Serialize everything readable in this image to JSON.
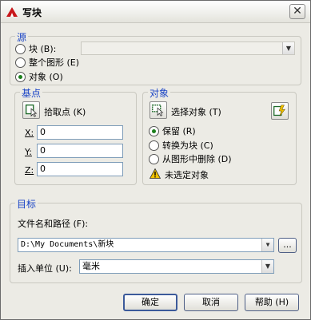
{
  "window": {
    "title": "写块",
    "close_glyph": "✕"
  },
  "source": {
    "label": "源",
    "opt_block": "块 (B):",
    "opt_entire": "整个图形 (E)",
    "opt_objects": "对象 (O)",
    "selected": "objects"
  },
  "base_point": {
    "label": "基点",
    "pick_label": "拾取点 (K)",
    "x_label": "X:",
    "x_value": "0",
    "y_label": "Y:",
    "y_value": "0",
    "z_label": "Z:",
    "z_value": "0"
  },
  "objects": {
    "label": "对象",
    "select_label": "选择对象 (T)",
    "opt_retain": "保留 (R)",
    "opt_convert": "转换为块 (C)",
    "opt_delete": "从图形中删除 (D)",
    "selected": "retain",
    "warning": "未选定对象"
  },
  "target": {
    "label": "目标",
    "path_label": "文件名和路径 (F):",
    "path_value": "D:\\My Documents\\新块",
    "browse_label": "...",
    "units_label": "插入单位 (U):",
    "units_value": "毫米"
  },
  "buttons": {
    "ok": "确定",
    "cancel": "取消",
    "help": "帮助 (H)"
  },
  "colors": {
    "group_label": "#1c46c6",
    "radio_on": "#1b7f1b",
    "warning": "#f2c200"
  }
}
